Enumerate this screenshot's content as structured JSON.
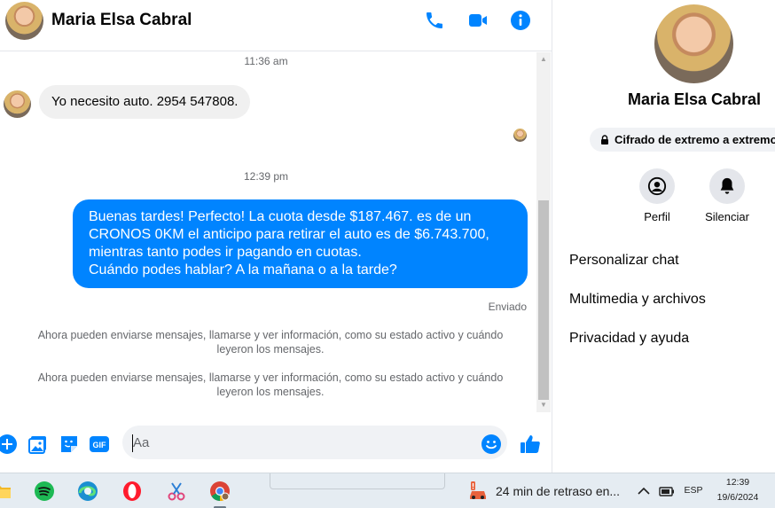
{
  "contact": {
    "name": "Maria Elsa Cabral"
  },
  "messages": {
    "timestamp_1": "11:36 am",
    "incoming_text": "Yo necesito auto.  2954 547808.",
    "timestamp_2": "12:39 pm",
    "outgoing_lines": [
      "Buenas tardes! Perfecto! La cuota desde $187.467. es de un",
      "CRONOS 0KM el anticipo para retirar el auto es de $6.743.700,",
      "mientras tanto podes ir pagando en cuotas.",
      "Cuándo podes hablar? A la mañana o a la tarde?"
    ],
    "status": "Enviado",
    "system_1": "Ahora pueden enviarse mensajes, llamarse y ver información, como su estado activo y cuándo leyeron los mensajes.",
    "system_2": "Ahora pueden enviarse mensajes, llamarse y ver información, como su estado activo y cuándo leyeron los mensajes."
  },
  "composer": {
    "placeholder": "Aa",
    "gif_label": "GIF"
  },
  "details": {
    "encryption_label": "Cifrado de extremo a extremo",
    "actions": [
      "Perfil",
      "Silenciar"
    ],
    "menu": [
      "Personalizar chat",
      "Multimedia y archivos",
      "Privacidad y ayuda"
    ]
  },
  "taskbar": {
    "notification": "24 min de retraso en...",
    "language": "ESP",
    "time": "12:39",
    "date": "19/6/2024"
  },
  "colors": {
    "brand": "#0084ff",
    "incoming_bubble": "#f0f0f0",
    "muted_text": "#65676b"
  }
}
